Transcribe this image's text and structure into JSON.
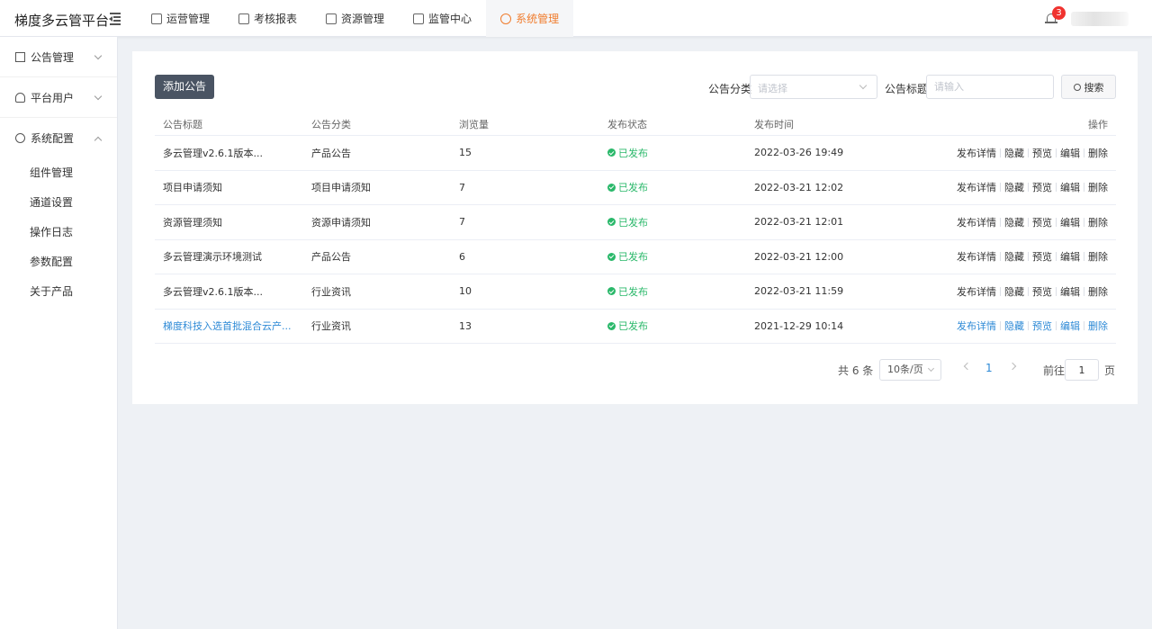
{
  "app": {
    "title": "梯度多云管平台"
  },
  "topnav": [
    {
      "label": "运营管理",
      "icon": "ops-icon",
      "active": false
    },
    {
      "label": "考核报表",
      "icon": "report-icon",
      "active": false
    },
    {
      "label": "资源管理",
      "icon": "layers-icon",
      "active": false
    },
    {
      "label": "监管中心",
      "icon": "monitor-icon",
      "active": false
    },
    {
      "label": "系统管理",
      "icon": "gear-icon",
      "active": true
    }
  ],
  "notifications": {
    "count": "3"
  },
  "sidebar": {
    "groups": [
      {
        "label": "公告管理",
        "icon": "book-icon",
        "expanded": false
      },
      {
        "label": "平台用户",
        "icon": "user-icon",
        "expanded": false
      },
      {
        "label": "系统配置",
        "icon": "gear-icon",
        "expanded": true
      }
    ],
    "subitems": [
      "组件管理",
      "通道设置",
      "操作日志",
      "参数配置",
      "关于产品"
    ]
  },
  "toolbar": {
    "add_label": "添加公告",
    "category_label": "公告分类",
    "category_placeholder": "请选择",
    "title_label": "公告标题",
    "title_placeholder": "请输入",
    "search_label": "搜索"
  },
  "table": {
    "headers": [
      "公告标题",
      "公告分类",
      "浏览量",
      "发布状态",
      "发布时间",
      "操作"
    ],
    "rows": [
      {
        "title": "多云管理v2.6.1版本...",
        "category": "产品公告",
        "views": "15",
        "status": "已发布",
        "time": "2022-03-26 19:49"
      },
      {
        "title": "项目申请须知",
        "category": "项目申请须知",
        "views": "7",
        "status": "已发布",
        "time": "2022-03-21 12:02"
      },
      {
        "title": "资源管理须知",
        "category": "资源申请须知",
        "views": "7",
        "status": "已发布",
        "time": "2022-03-21 12:01"
      },
      {
        "title": "多云管理演示环境测试",
        "category": "产品公告",
        "views": "6",
        "status": "已发布",
        "time": "2022-03-21 12:00"
      },
      {
        "title": "多云管理v2.6.1版本...",
        "category": "行业资讯",
        "views": "10",
        "status": "已发布",
        "time": "2022-03-21 11:59"
      },
      {
        "title": "梯度科技入选首批混合云产...",
        "category": "行业资讯",
        "views": "13",
        "status": "已发布",
        "time": "2021-12-29 10:14"
      }
    ],
    "actions": [
      "发布详情",
      "隐藏",
      "预览",
      "编辑",
      "删除"
    ]
  },
  "pagination": {
    "total": "共 6 条",
    "page_size": "10条/页",
    "current": "1",
    "goto_label": "前往",
    "goto_value": "1",
    "page_suffix": "页"
  },
  "colors": {
    "accent": "#f07c2d",
    "link": "#2e8ad6",
    "success": "#2ab86a",
    "primary_button": "#4a5463",
    "badge": "#f0332f"
  }
}
